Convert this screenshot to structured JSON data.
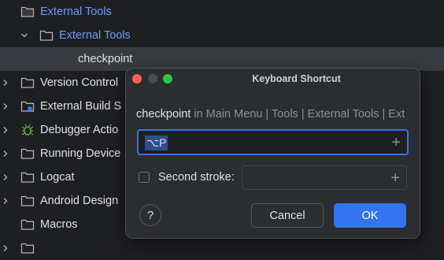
{
  "tree": {
    "items": [
      {
        "label": "External Tools",
        "icon": "folder-icon"
      },
      {
        "label": "External Tools",
        "icon": "folder-icon"
      },
      {
        "label": "checkpoint"
      },
      {
        "label": "Version Control",
        "icon": "folder-icon"
      },
      {
        "label": "External Build S",
        "icon": "build-folder-icon"
      },
      {
        "label": "Debugger Actio",
        "icon": "bug-icon"
      },
      {
        "label": "Running Device",
        "icon": "folder-icon"
      },
      {
        "label": "Logcat",
        "icon": "folder-icon"
      },
      {
        "label": "Android Design",
        "icon": "folder-icon"
      },
      {
        "label": "Macros",
        "icon": "folder-icon"
      }
    ]
  },
  "dialog": {
    "title": "Keyboard Shortcut",
    "action_name": "checkpoint",
    "action_path": " in Main Menu | Tools | External Tools | Ext",
    "first_stroke_value": "⌥P",
    "add_glyph": "+",
    "second_stroke_label": "Second stroke:",
    "second_stroke_checked": false,
    "help_glyph": "?",
    "cancel_label": "Cancel",
    "ok_label": "OK"
  },
  "colors": {
    "accent": "#3574f0",
    "link_blue": "#6b9bfa",
    "close": "#ff5f57",
    "inactive_light": "#4a4c50",
    "zoom": "#28c840",
    "bug": "#5fb832"
  }
}
